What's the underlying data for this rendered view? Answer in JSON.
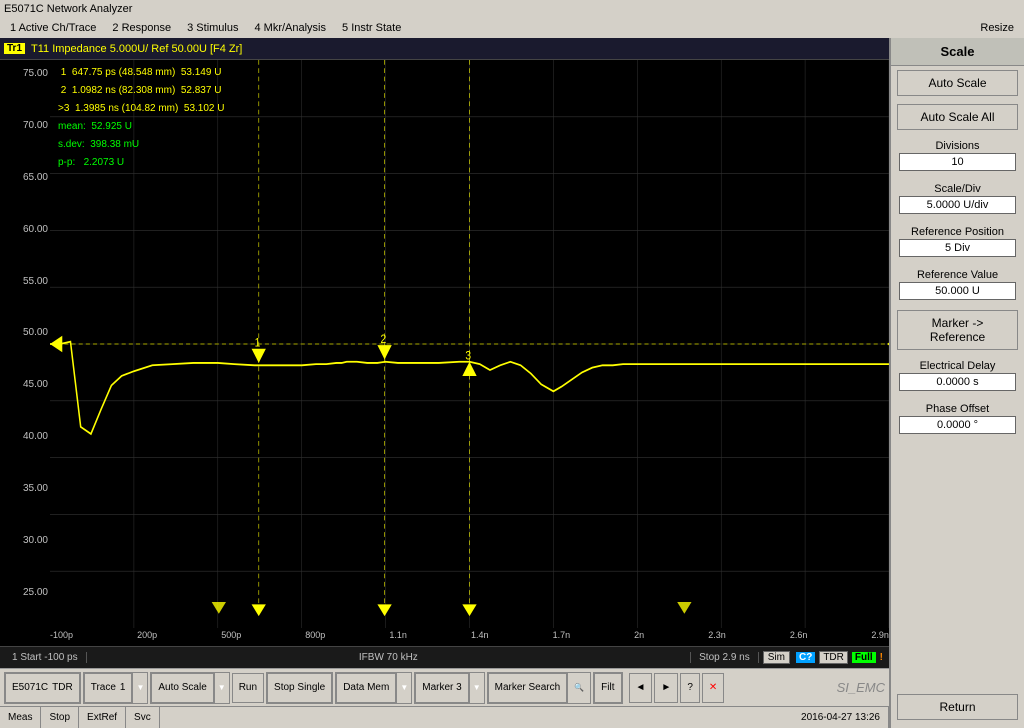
{
  "titleBar": {
    "text": "E5071C Network Analyzer"
  },
  "menuBar": {
    "items": [
      "1 Active Ch/Trace",
      "2 Response",
      "3 Stimulus",
      "4 Mkr/Analysis",
      "5 Instr State"
    ],
    "resize": "Resize"
  },
  "chartHeader": {
    "badge": "Tr1",
    "label": "T11  Impedance  5.000U/  Ref  50.00U  [F4 Zr]"
  },
  "markers": [
    {
      "id": "1",
      "time": "647.75 ps",
      "mmVal": "(48.548 mm)",
      "value": "53.149 U"
    },
    {
      "id": "2",
      "time": "1.0982 ns",
      "mmVal": "(82.308 mm)",
      "value": "52.837 U"
    },
    {
      "id": ">3",
      "time": "1.3985 ns",
      "mmVal": "(104.82 mm)",
      "value": "53.102 U"
    }
  ],
  "stats": {
    "mean": "52.925 U",
    "sdev": "398.38 mU",
    "pp": "2.2073 U"
  },
  "yAxis": {
    "labels": [
      "75.00",
      "70.00",
      "65.00",
      "60.00",
      "55.00",
      "50.00",
      "45.00",
      "40.00",
      "35.00",
      "30.00",
      "25.00"
    ]
  },
  "xAxis": {
    "labels": [
      "-100p",
      "200p",
      "500p",
      "800p",
      "1.1n",
      "1.4n",
      "1.7n",
      "2n",
      "2.3n",
      "2.6n",
      "2.9n"
    ]
  },
  "statusBar": {
    "left": "1  Start -100 ps",
    "center": "IFBW 70 kHz",
    "right": "Stop 2.9 ns"
  },
  "simBadges": {
    "sim": "Sim",
    "c": "C?",
    "tdr": "TDR",
    "full": "Full",
    "excl": "!"
  },
  "rightPanel": {
    "title": "Scale",
    "autoScale": "Auto Scale",
    "autoScaleAll": "Auto Scale All",
    "divisionsLabel": "Divisions",
    "divisionsValue": "10",
    "scalePerDivLabel": "Scale/Div",
    "scalePerDivValue": "5.0000 U/div",
    "refPositionLabel": "Reference Position",
    "refPositionValue": "5 Div",
    "refValueLabel": "Reference Value",
    "refValueValue": "50.000 U",
    "markerToRef": "Marker ->\nReference",
    "electricalDelayLabel": "Electrical Delay",
    "electricalDelayValue": "0.0000 s",
    "phaseOffsetLabel": "Phase Offset",
    "phaseOffsetValue": "0.0000 °",
    "return": "Return"
  },
  "toolbar": {
    "instrument": "E5071C",
    "mode": "TDR",
    "trace": "Trace",
    "traceNum": "1",
    "autoScale": "Auto Scale",
    "run": "Run",
    "stopSingle": "Stop Single",
    "dataMem": "Data Mem",
    "marker3": "Marker 3",
    "markerSearch": "Marker Search",
    "filter": "Filt",
    "logo": "SI_EMC"
  },
  "bottomBar": {
    "meas": "Meas",
    "stop": "Stop",
    "extRef": "ExtRef",
    "svc": "Svc",
    "datetime": "2016-04-27  13:26"
  },
  "colors": {
    "traceColor": "#ffff00",
    "markerColor": "#ffff00",
    "refLineColor": "#888800",
    "gridColor": "#333333",
    "bgColor": "#000000"
  }
}
